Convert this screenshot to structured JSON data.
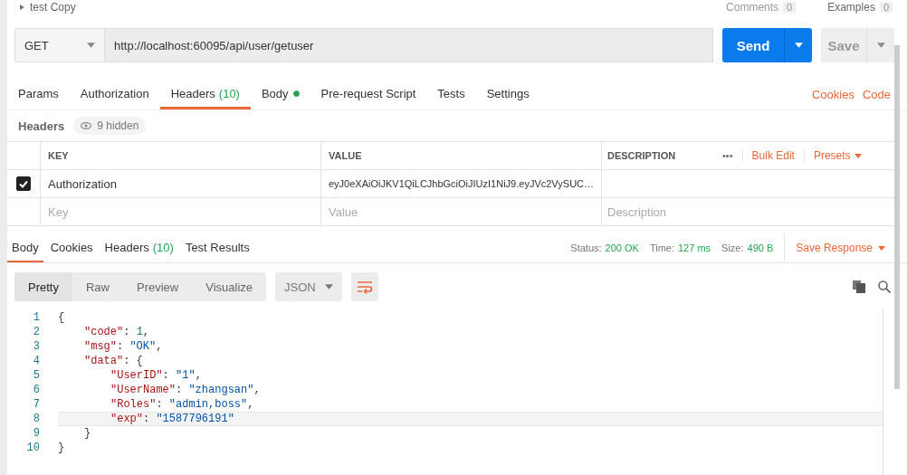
{
  "top_bar": {
    "request_name": "test Copy",
    "comments": {
      "label": "Comments",
      "count": "0"
    },
    "examples": {
      "label": "Examples",
      "count": "0"
    }
  },
  "request": {
    "method": "GET",
    "url": "http://localhost:60095/api/user/getuser",
    "send": "Send",
    "save": "Save"
  },
  "request_tabs": [
    {
      "label": "Params",
      "selected": false
    },
    {
      "label": "Authorization",
      "selected": false
    },
    {
      "label": "Headers",
      "count": "(10)",
      "selected": true
    },
    {
      "label": "Body",
      "dot": true,
      "selected": false
    },
    {
      "label": "Pre-request Script",
      "selected": false
    },
    {
      "label": "Tests",
      "selected": false
    },
    {
      "label": "Settings",
      "selected": false
    }
  ],
  "request_links": [
    "Cookies",
    "Code"
  ],
  "headers": {
    "title": "Headers",
    "hidden": "9 hidden",
    "columns": [
      "KEY",
      "VALUE",
      "DESCRIPTION"
    ],
    "more": "•••",
    "bulk_edit": "Bulk Edit",
    "presets": "Presets",
    "rows": [
      {
        "checked": true,
        "key": "Authorization",
        "value": "eyJ0eXAiOiJKV1QiLCJhbGciOiJIUzI1NiJ9.eyJVc2VySUC…"
      }
    ],
    "new_row": [
      {
        "placeholder": "Key"
      },
      {
        "placeholder": "Value"
      },
      {
        "placeholder": "Description"
      }
    ]
  },
  "response_tabs": [
    {
      "label": "Body",
      "selected": true
    },
    {
      "label": "Cookies",
      "selected": false
    },
    {
      "label": "Headers",
      "count": "(10)",
      "selected": false
    },
    {
      "label": "Test Results",
      "selected": false
    }
  ],
  "response_meta": [
    {
      "label": "Status:",
      "value": "200 OK"
    },
    {
      "label": "Time:",
      "value": "127 ms"
    },
    {
      "label": "Size:",
      "value": "490 B"
    }
  ],
  "save_response": "Save Response",
  "view_modes": [
    {
      "label": "Pretty",
      "selected": true
    },
    {
      "label": "Raw",
      "selected": false
    },
    {
      "label": "Preview",
      "selected": false
    },
    {
      "label": "Visualize",
      "selected": false
    }
  ],
  "format": "JSON",
  "code": [
    {
      "number": "1",
      "tokens": [
        {
          "kind": "punct",
          "text": "{"
        }
      ],
      "children": [
        {
          "number": "2",
          "tokens": [
            {
              "kind": "key",
              "text": "\"code\""
            },
            {
              "kind": "punct",
              "text": ": "
            },
            {
              "kind": "number",
              "text": "1"
            },
            {
              "kind": "punct",
              "text": ","
            }
          ]
        },
        {
          "number": "3",
          "tokens": [
            {
              "kind": "key",
              "text": "\"msg\""
            },
            {
              "kind": "punct",
              "text": ": "
            },
            {
              "kind": "string",
              "text": "\"OK\""
            },
            {
              "kind": "punct",
              "text": ","
            }
          ]
        },
        {
          "number": "4",
          "tokens": [
            {
              "kind": "key",
              "text": "\"data\""
            },
            {
              "kind": "punct",
              "text": ": {"
            }
          ],
          "children": [
            {
              "number": "5",
              "tokens": [
                {
                  "kind": "key",
                  "text": "\"UserID\""
                },
                {
                  "kind": "punct",
                  "text": ": "
                },
                {
                  "kind": "string",
                  "text": "\"1\""
                },
                {
                  "kind": "punct",
                  "text": ","
                }
              ]
            },
            {
              "number": "6",
              "tokens": [
                {
                  "kind": "key",
                  "text": "\"UserName\""
                },
                {
                  "kind": "punct",
                  "text": ": "
                },
                {
                  "kind": "string",
                  "text": "\"zhangsan\""
                },
                {
                  "kind": "punct",
                  "text": ","
                }
              ]
            },
            {
              "number": "7",
              "tokens": [
                {
                  "kind": "key",
                  "text": "\"Roles\""
                },
                {
                  "kind": "punct",
                  "text": ": "
                },
                {
                  "kind": "string",
                  "text": "\"admin,boss\""
                },
                {
                  "kind": "punct",
                  "text": ","
                }
              ]
            },
            {
              "number": "8",
              "current": true,
              "tokens": [
                {
                  "kind": "key",
                  "text": "\"exp\""
                },
                {
                  "kind": "punct",
                  "text": ": "
                },
                {
                  "kind": "string",
                  "text": "\"1587796191\""
                }
              ]
            }
          ]
        },
        {
          "number": "9",
          "tokens": [
            {
              "kind": "punct",
              "text": "}"
            }
          ]
        }
      ]
    },
    {
      "number": "10",
      "tokens": [
        {
          "kind": "punct",
          "text": "}"
        }
      ]
    }
  ]
}
